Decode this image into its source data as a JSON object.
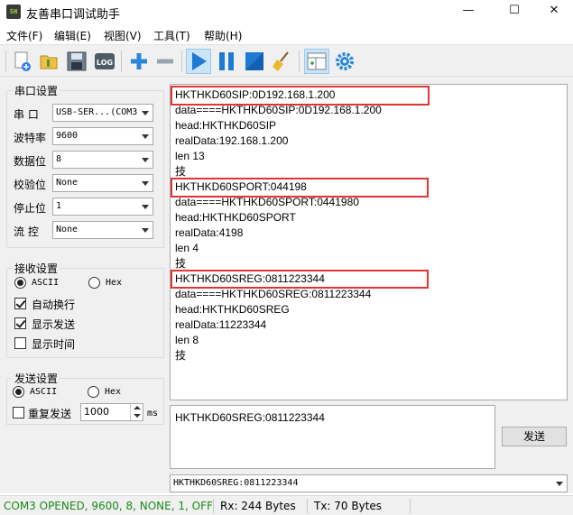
{
  "window": {
    "title": "友善串口调试助手",
    "icon_text": "SH",
    "minimize": "—",
    "maximize": "☐",
    "close": "✕"
  },
  "menu": [
    "文件(F)",
    "编辑(E)",
    "视图(V)",
    "工具(T)",
    "帮助(H)"
  ],
  "toolbar": {
    "log_label": "LOG"
  },
  "serial": {
    "title": "串口设置",
    "port_label": "串  口",
    "port_value": "USB-SER...(COM3",
    "baud_label": "波特率",
    "baud_value": "9600",
    "databits_label": "数据位",
    "databits_value": "8",
    "parity_label": "校验位",
    "parity_value": "None",
    "stopbits_label": "停止位",
    "stopbits_value": "1",
    "flow_label": "流  控",
    "flow_value": "None"
  },
  "receive": {
    "title": "接收设置",
    "ascii_label": "ASCII",
    "hex_label": "Hex",
    "autowrap_label": "自动换行",
    "showsend_label": "显示发送",
    "showtime_label": "显示时间"
  },
  "send_settings": {
    "title": "发送设置",
    "ascii_label": "ASCII",
    "hex_label": "Hex",
    "repeat_label": "重复发送",
    "interval_value": "1000",
    "unit": "ms"
  },
  "recv_lines": [
    "HKTHKD60SIP:0D192.168.1.200",
    "data====HKTHKD60SIP:0D192.168.1.200",
    "head:HKTHKD60SIP",
    "realData:192.168.1.200",
    "len 13",
    "技",
    "HKTHKD60SPORT:044198",
    "data====HKTHKD60SPORT:0441980",
    "head:HKTHKD60SPORT",
    "realData:4198",
    "len 4",
    "技",
    "HKTHKD60SREG:0811223344",
    "data====HKTHKD60SREG:0811223344",
    "head:HKTHKD60SREG",
    "realData:11223344",
    "len 8",
    "技"
  ],
  "send_text": "HKTHKD60SREG:0811223344",
  "send_button": "发送",
  "send_history": "HKTHKD60SREG:0811223344",
  "status": {
    "conn": "COM3 OPENED, 9600, 8, NONE, 1, OFF",
    "rx": "Rx: 244 Bytes",
    "tx": "Tx: 70 Bytes",
    "conn_color": "#1a8a1a",
    "highlight_color": "#e03535"
  }
}
